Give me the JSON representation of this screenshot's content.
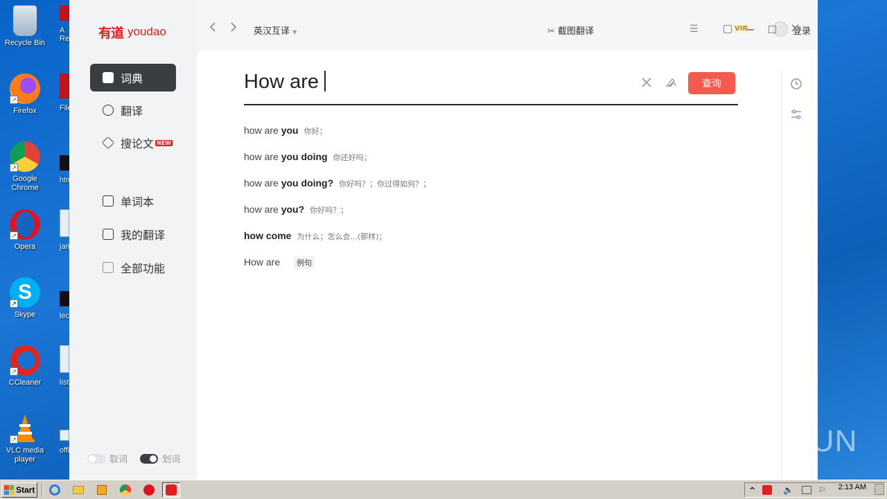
{
  "desktop": {
    "icons": [
      {
        "label": "Recycle Bin",
        "icon": "recycle-bin-icon"
      },
      {
        "label": "Firefox",
        "icon": "firefox-icon"
      },
      {
        "label": "Google Chrome",
        "icon": "chrome-icon"
      },
      {
        "label": "Opera",
        "icon": "opera-icon"
      },
      {
        "label": "Skype",
        "icon": "skype-icon"
      },
      {
        "label": "CCleaner",
        "icon": "ccleaner-icon"
      },
      {
        "label": "VLC media player",
        "icon": "vlc-icon"
      }
    ],
    "partial_labels": [
      "A",
      "Re",
      "FileZ",
      "htm",
      "jame",
      "lec",
      "listec",
      "office"
    ],
    "watermark": "ANY.RUN"
  },
  "app": {
    "logo_mark": "有道",
    "logo_word": "youdao",
    "nav": [
      {
        "label": "词典",
        "icon": "dictionary-icon",
        "active": true
      },
      {
        "label": "翻译",
        "icon": "translate-icon",
        "active": false
      },
      {
        "label": "搜论文",
        "icon": "graduation-cap-icon",
        "active": false,
        "badge": "NEW"
      },
      {
        "label": "单词本",
        "icon": "wordbook-icon",
        "active": false
      },
      {
        "label": "我的翻译",
        "icon": "my-translation-icon",
        "active": false
      },
      {
        "label": "全部功能",
        "icon": "all-features-icon",
        "active": false
      }
    ],
    "toggles": [
      {
        "label": "取词",
        "on": false
      },
      {
        "label": "划词",
        "on": true
      }
    ],
    "header": {
      "language": "英汉互译",
      "screenshot_translate": "截图翻译",
      "vip": "VIP",
      "login": "登录"
    },
    "search": {
      "query": "How are",
      "button": "查询"
    },
    "suggestions": [
      {
        "light": "how are ",
        "bold": "you",
        "cn": "你好；"
      },
      {
        "light": "how are ",
        "bold": "you doing",
        "cn": "你还好吗；"
      },
      {
        "light": "how are ",
        "bold": "you doing?",
        "cn": "你好吗？；你过得如何？；"
      },
      {
        "light": "how are ",
        "bold": "you?",
        "cn": "你好吗？；"
      },
      {
        "light": "how ",
        "bold": "come",
        "cn": "为什么；怎么会...(那样)；"
      }
    ],
    "example_row": {
      "phrase": "How are",
      "tag": "例句"
    }
  },
  "taskbar": {
    "start": "Start",
    "clock": "2:13 AM",
    "tray_chevron": "^"
  }
}
